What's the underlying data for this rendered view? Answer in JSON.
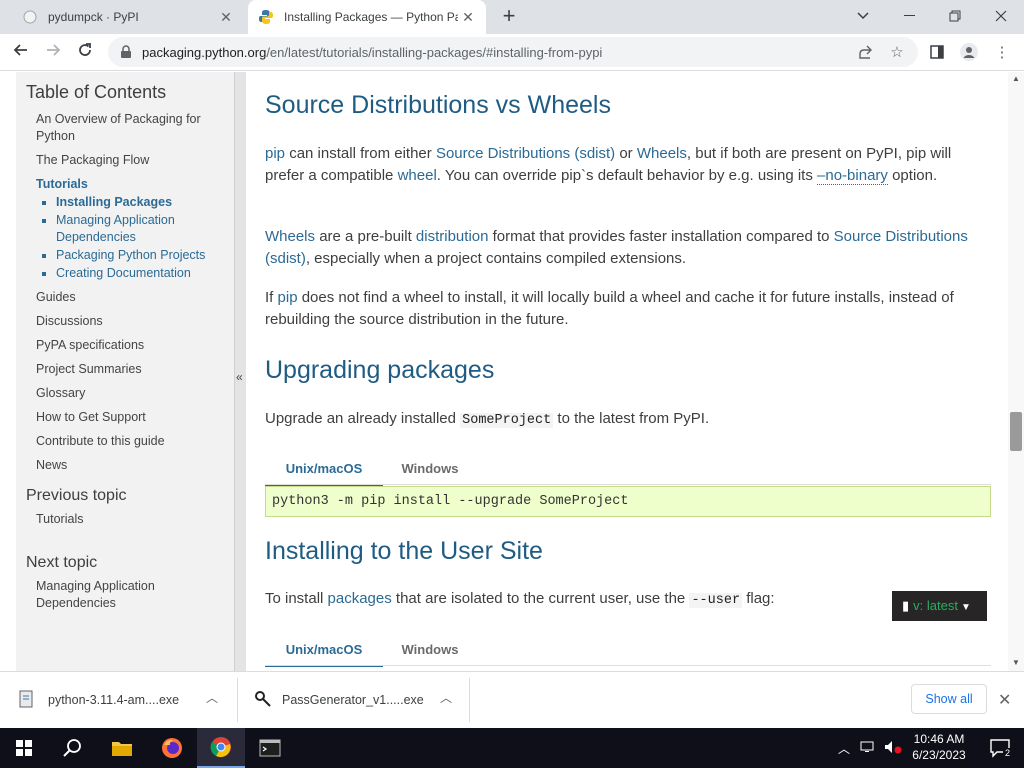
{
  "browser": {
    "tabs": [
      {
        "title": "pydumpck · PyPI",
        "active": false
      },
      {
        "title": "Installing Packages — Python Pac",
        "active": true
      }
    ],
    "url_host": "packaging.python.org",
    "url_path": "/en/latest/tutorials/installing-packages/#installing-from-pypi"
  },
  "sidebar": {
    "heading": "Table of Contents",
    "items": [
      {
        "label": "An Overview of Packaging for Python"
      },
      {
        "label": "The Packaging Flow"
      },
      {
        "label": "Tutorials"
      },
      {
        "label": "Guides"
      },
      {
        "label": "Discussions"
      },
      {
        "label": "PyPA specifications"
      },
      {
        "label": "Project Summaries"
      },
      {
        "label": "Glossary"
      },
      {
        "label": "How to Get Support"
      },
      {
        "label": "Contribute to this guide"
      },
      {
        "label": "News"
      }
    ],
    "tutorials_children": [
      {
        "label": "Installing Packages"
      },
      {
        "label": "Managing Application Dependencies"
      },
      {
        "label": "Packaging Python Projects"
      },
      {
        "label": "Creating Documentation"
      }
    ],
    "prev_heading": "Previous topic",
    "prev_link": "Tutorials",
    "next_heading": "Next topic",
    "next_link": "Managing Application Dependencies",
    "collapse_glyph": "«"
  },
  "content": {
    "h_source": "Source Distributions vs Wheels",
    "p1": {
      "a": "pip",
      "b": " can install from either ",
      "c": "Source Distributions (sdist)",
      "d": " or ",
      "e": "Wheels",
      "f": ", but if both are present on PyPI, pip will prefer a compatible ",
      "g": "wheel",
      "h": ". You can override pip`s default behavior by e.g. using its ",
      "i": "–no-binary",
      "j": " option."
    },
    "p2": {
      "a": "Wheels",
      "b": " are a pre-built ",
      "c": "distribution",
      "d": " format that provides faster installation compared to ",
      "e": "Source Distributions (sdist)",
      "f": ", especially when a project contains compiled extensions."
    },
    "p3": {
      "a": "If ",
      "b": "pip",
      "c": " does not find a wheel to install, it will locally build a wheel and cache it for future installs, instead of rebuilding the source distribution in the future."
    },
    "h_upgrade": "Upgrading packages",
    "p4": {
      "a": "Upgrade an already installed ",
      "code": "SomeProject",
      "b": " to the latest from PyPI."
    },
    "tabs": [
      "Unix/macOS",
      "Windows"
    ],
    "cmd_upgrade": "python3 -m pip install --upgrade SomeProject",
    "h_user": "Installing to the User Site",
    "p5": {
      "a": "To install ",
      "b": "packages",
      "c": " that are isolated to the current user, use the ",
      "code": "--user",
      "d": " flag:"
    },
    "version_badge": "v: latest"
  },
  "downloads": {
    "items": [
      {
        "name": "python-3.11.4-am....exe"
      },
      {
        "name": "PassGenerator_v1.....exe"
      }
    ],
    "show_all": "Show all"
  },
  "taskbar": {
    "time": "10:46 AM",
    "date": "6/23/2023",
    "notif_count": "2"
  },
  "colors": {
    "link": "#2b6a95",
    "heading": "#1f5c84",
    "code_bg": "#eeffcc",
    "badge_text": "#27ae60"
  }
}
